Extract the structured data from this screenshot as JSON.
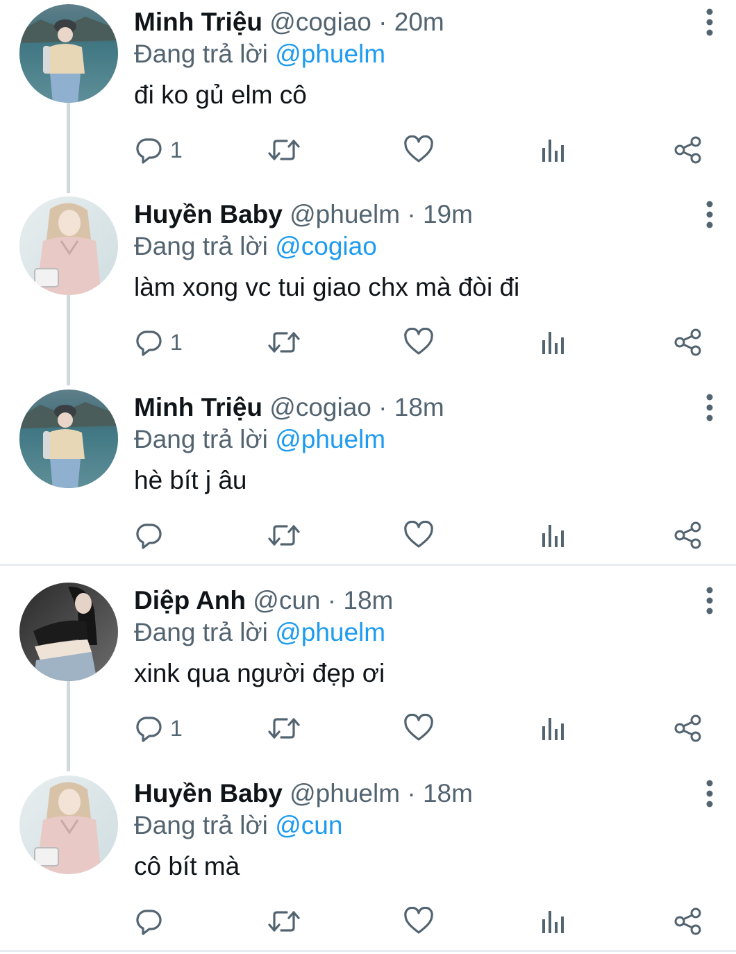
{
  "replying_label": "Đang trả lời",
  "tweets": [
    {
      "name": "Minh Triệu",
      "handle": "@cogiao",
      "time": "20m",
      "reply_to": "@phuelm",
      "text": "đi ko gủ elm cô",
      "reply_count": "1",
      "avatar": "minh-trieu"
    },
    {
      "name": "Huyền Baby",
      "handle": "@phuelm",
      "time": "19m",
      "reply_to": "@cogiao",
      "text": "làm xong vc tui giao chx mà đòi đi",
      "reply_count": "1",
      "avatar": "huyen-baby"
    },
    {
      "name": "Minh Triệu",
      "handle": "@cogiao",
      "time": "18m",
      "reply_to": "@phuelm",
      "text": "hè bít j âu",
      "reply_count": "",
      "avatar": "minh-trieu"
    },
    {
      "name": "Diệp Anh",
      "handle": "@cun",
      "time": "18m",
      "reply_to": "@phuelm",
      "text": "xink qua người đẹp ơi",
      "reply_count": "1",
      "avatar": "diep-anh"
    },
    {
      "name": "Huyền Baby",
      "handle": "@phuelm",
      "time": "18m",
      "reply_to": "@cun",
      "text": "cô bít mà",
      "reply_count": "",
      "avatar": "huyen-baby"
    }
  ],
  "separator": "·",
  "colors": {
    "text": "#0f1419",
    "secondary": "#536471",
    "link": "#1d9bf0",
    "thread_line": "#cfd9de",
    "divider": "#e6ecf0"
  },
  "icons": [
    "reply-icon",
    "retweet-icon",
    "like-icon",
    "views-icon",
    "share-icon",
    "more-icon"
  ]
}
